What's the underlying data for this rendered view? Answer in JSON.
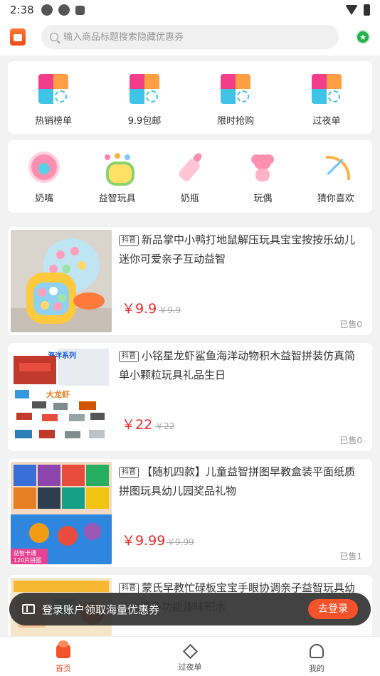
{
  "status_bar": {
    "time": "2:38"
  },
  "search": {
    "placeholder": "输入商品标题搜索隐藏优惠券"
  },
  "categories_row1": [
    {
      "label": "热销榜单",
      "icon": "puzzle-icon"
    },
    {
      "label": "9.9包邮",
      "icon": "puzzle-icon"
    },
    {
      "label": "限时抢购",
      "icon": "puzzle-icon"
    },
    {
      "label": "过夜单",
      "icon": "puzzle-icon"
    }
  ],
  "categories_row2": [
    {
      "label": "奶嘴",
      "icon": "pacifier-icon"
    },
    {
      "label": "益智玩具",
      "icon": "paw-icon"
    },
    {
      "label": "奶瓶",
      "icon": "bottle-icon"
    },
    {
      "label": "玩偶",
      "icon": "bear-icon"
    },
    {
      "label": "猜你喜欢",
      "icon": "bow-icon"
    }
  ],
  "products": [
    {
      "tag": "抖音",
      "title": "新品掌中小鸭打地鼠解压玩具宝宝按按乐幼儿迷你可爱亲子互动益智",
      "price": "￥9.9",
      "old_price": "￥9.9",
      "sold": "已售0"
    },
    {
      "tag": "抖音",
      "title": "小铭星龙虾鲨鱼海洋动物积木益智拼装仿真简单小颗粒玩具礼品生日",
      "price": "￥22",
      "old_price": "￥22",
      "sold": "已售0",
      "thumb_text": {
        "series": "海洋系列",
        "name": "大龙虾"
      }
    },
    {
      "tag": "抖音",
      "title": "【随机四款】儿童益智拼图早教盒装平面纸质拼图玩具幼儿园奖品礼物",
      "price": "￥9.99",
      "old_price": "￥9.99",
      "sold": "已售1",
      "thumb_text": {
        "line1": "益智卡通",
        "line2": "120片拼图"
      }
    },
    {
      "tag": "抖音",
      "title": "蒙氏早教忙碌板宝宝手眼协调亲子益智玩具幼儿木质多功能趣味积木",
      "price": "",
      "old_price": "",
      "sold": ""
    }
  ],
  "toast": {
    "message": "登录账户领取海量优惠券",
    "button": "去登录"
  },
  "tabbar": [
    {
      "label": "首页",
      "active": true
    },
    {
      "label": "过夜单",
      "active": false
    },
    {
      "label": "我的",
      "active": false
    }
  ],
  "colors": {
    "accent": "#f4522a",
    "price": "#f02a2a"
  }
}
